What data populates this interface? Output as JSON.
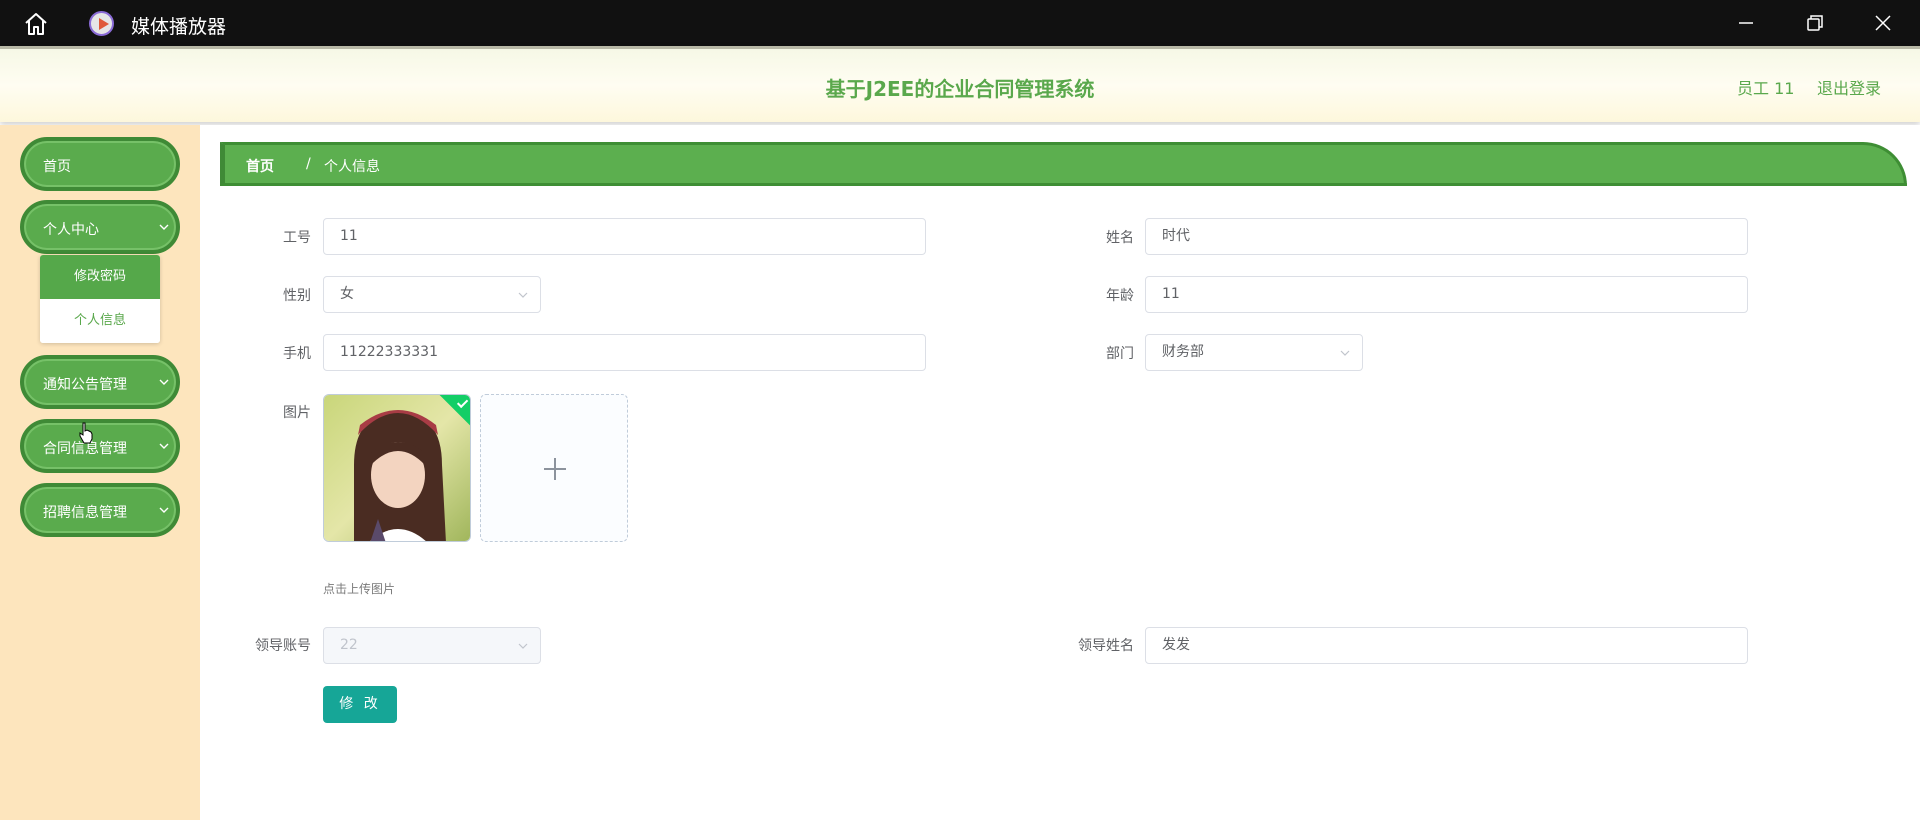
{
  "window": {
    "app_title": "媒体播放器"
  },
  "header": {
    "system_title": "基于J2EE的企业合同管理系统",
    "user_name": "员工 11",
    "logout_label": "退出登录"
  },
  "sidebar": {
    "items": [
      {
        "label": "首页"
      },
      {
        "label": "个人中心"
      },
      {
        "label": "通知公告管理"
      },
      {
        "label": "合同信息管理"
      },
      {
        "label": "招聘信息管理"
      }
    ],
    "submenu": [
      {
        "label": "修改密码"
      },
      {
        "label": "个人信息"
      }
    ]
  },
  "breadcrumb": {
    "home": "首页",
    "separator": "/",
    "current": "个人信息"
  },
  "form": {
    "employee_id": {
      "label": "工号",
      "value": "11"
    },
    "name": {
      "label": "姓名",
      "value": "时代"
    },
    "gender": {
      "label": "性别",
      "value": "女"
    },
    "age": {
      "label": "年龄",
      "value": "11"
    },
    "phone": {
      "label": "手机",
      "value": "11222333331"
    },
    "department": {
      "label": "部门",
      "value": "财务部"
    },
    "photo": {
      "label": "图片",
      "tip": "点击上传图片"
    },
    "leader_account": {
      "label": "领导账号",
      "value": "22"
    },
    "leader_name": {
      "label": "领导姓名",
      "value": "发发"
    },
    "submit_label": "修 改"
  },
  "colors": {
    "accent_green": "#5aab4d",
    "sidebar_bg": "#fde5bd",
    "submit_teal": "#16a697"
  }
}
